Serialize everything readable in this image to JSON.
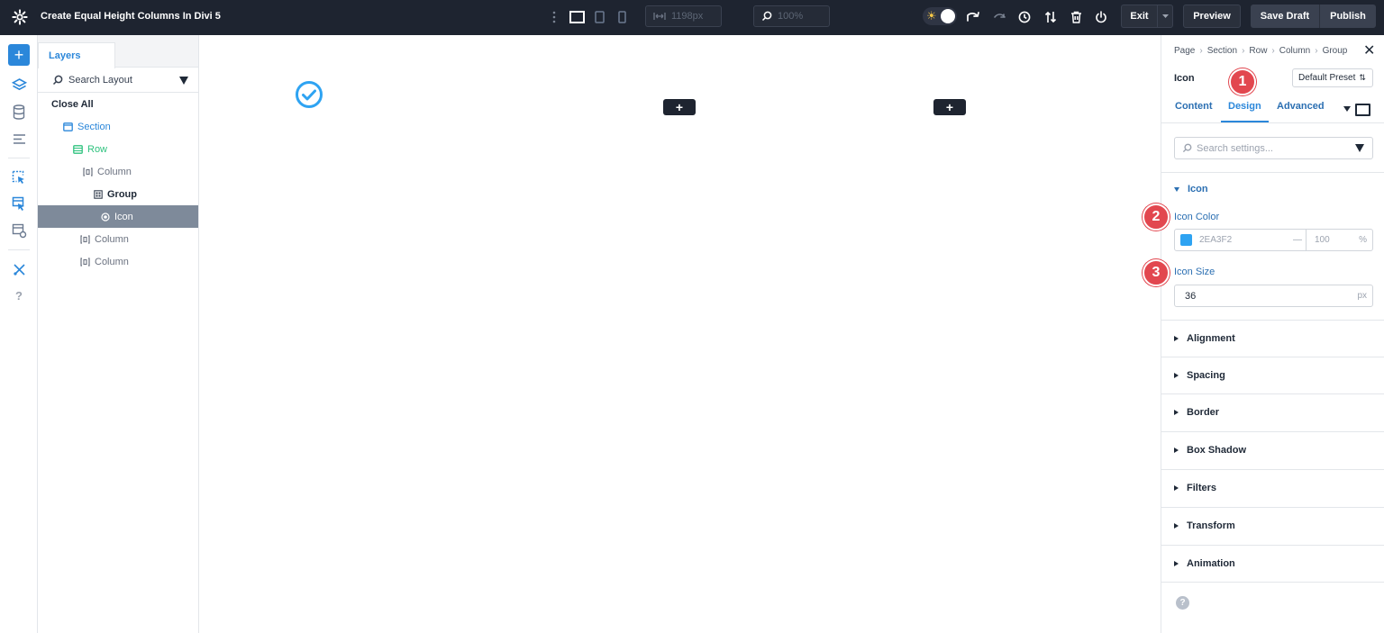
{
  "topbar": {
    "doc_title": "Create Equal Height Columns In Divi 5",
    "width_value": "1198px",
    "zoom_value": "100%",
    "exit_label": "Exit",
    "preview_label": "Preview",
    "save_draft_label": "Save Draft",
    "publish_label": "Publish"
  },
  "layers": {
    "tab_label": "Layers",
    "search_placeholder": "Search Layout",
    "close_all": "Close All",
    "items": [
      {
        "label": "Section"
      },
      {
        "label": "Row"
      },
      {
        "label": "Column"
      },
      {
        "label": "Group"
      },
      {
        "label": "Icon"
      },
      {
        "label": "Column"
      },
      {
        "label": "Column"
      }
    ]
  },
  "settings": {
    "breadcrumb": [
      "Page",
      "Section",
      "Row",
      "Column",
      "Group"
    ],
    "module_name": "Icon",
    "preset_label": "Default Preset",
    "tabs": [
      "Content",
      "Design",
      "Advanced"
    ],
    "search_placeholder": "Search settings...",
    "open_group": "Icon",
    "icon_color_label": "Icon Color",
    "icon_color_value": "2EA3F2",
    "icon_color_hex": "#2EA3F2",
    "opacity_value": "100",
    "opacity_unit": "%",
    "icon_size_label": "Icon Size",
    "icon_size_value": "36",
    "icon_size_unit": "px",
    "groups": [
      "Alignment",
      "Spacing",
      "Border",
      "Box Shadow",
      "Filters",
      "Transform",
      "Animation"
    ]
  },
  "steps": [
    "1",
    "2",
    "3"
  ],
  "colors": {
    "accent": "#2b87da",
    "topbar_bg": "#1e2430",
    "step_badge": "#e2474f",
    "row_green": "#2ec27e"
  }
}
